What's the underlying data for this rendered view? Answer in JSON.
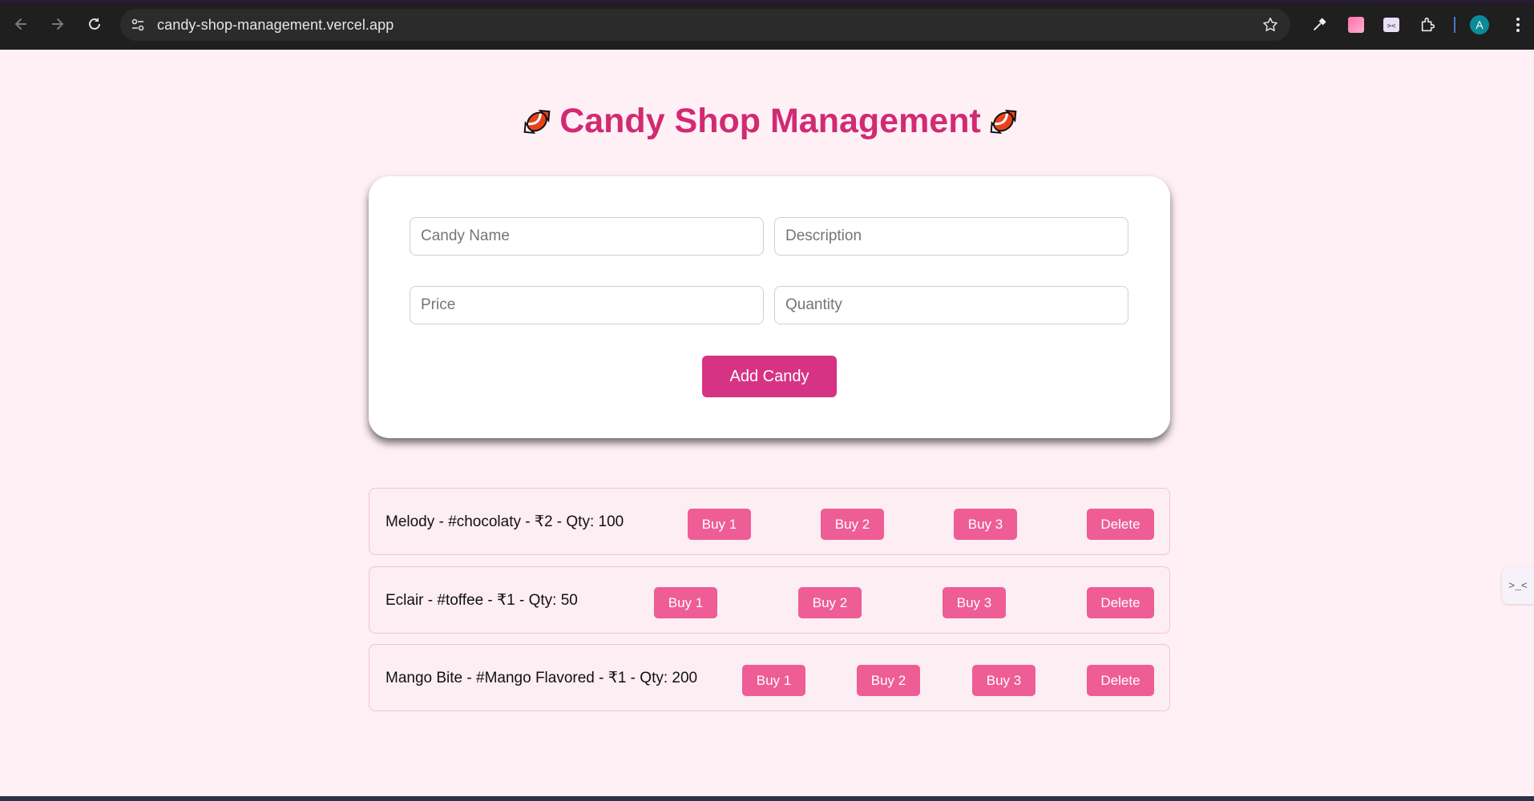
{
  "browser": {
    "url": "candy-shop-management.vercel.app",
    "profile_initial": "A",
    "icons": [
      "back-arrow-icon",
      "forward-arrow-icon",
      "reload-icon",
      "site-settings-icon",
      "bookmark-star-icon",
      "eyedropper-icon",
      "color-extension-icon",
      "face-extension-icon",
      "extensions-puzzle-icon"
    ]
  },
  "page": {
    "title": "Candy Shop Management",
    "title_icon": "candy-icon",
    "accent_color": "#d12a73"
  },
  "form": {
    "name_placeholder": "Candy Name",
    "description_placeholder": "Description",
    "price_placeholder": "Price",
    "quantity_placeholder": "Quantity",
    "submit_label": "Add Candy"
  },
  "candies": [
    {
      "text": "Melody - #chocolaty - ₹2 - Qty: 100",
      "buy1": "Buy 1",
      "buy2": "Buy 2",
      "buy3": "Buy 3",
      "delete": "Delete"
    },
    {
      "text": "Eclair - #toffee - ₹1 - Qty: 50",
      "buy1": "Buy 1",
      "buy2": "Buy 2",
      "buy3": "Buy 3",
      "delete": "Delete"
    },
    {
      "text": "Mango Bite - #Mango Flavored - ₹1 - Qty: 200",
      "buy1": "Buy 1",
      "buy2": "Buy 2",
      "buy3": "Buy 3",
      "delete": "Delete"
    }
  ],
  "side_widget": {
    "label": ">_<"
  }
}
